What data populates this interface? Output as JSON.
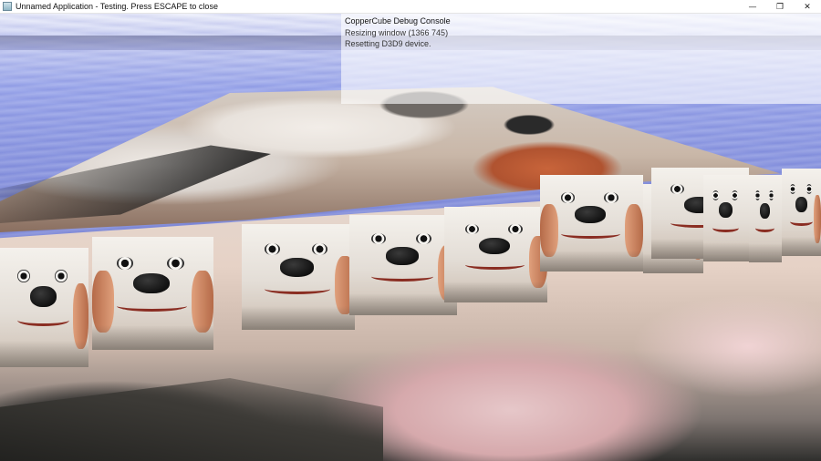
{
  "window": {
    "title": "Unnamed Application - Testing. Press ESCAPE to close",
    "controls": {
      "minimize": "—",
      "restore": "❐",
      "close": "✕"
    }
  },
  "debug_console": {
    "title": "CopperCube Debug Console",
    "lines": [
      "Resizing window (1366 745)",
      "Resetting D3D9 device."
    ]
  },
  "scene": {
    "sky_color": "#9aa6ea",
    "floor_color": "#e4d8d0",
    "dog_sprite_count": 11
  }
}
